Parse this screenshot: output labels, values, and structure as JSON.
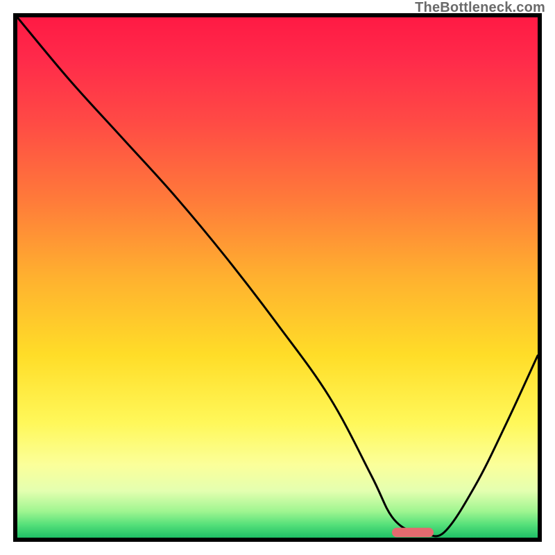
{
  "watermark": "TheBottleneck.com",
  "chart_data": {
    "type": "line",
    "title": "",
    "xlabel": "",
    "ylabel": "",
    "xlim": [
      0,
      100
    ],
    "ylim": [
      0,
      100
    ],
    "series": [
      {
        "name": "bottleneck-curve",
        "x": [
          0,
          10,
          20,
          30,
          40,
          50,
          60,
          68,
          72,
          76,
          78,
          82,
          88,
          94,
          100
        ],
        "y": [
          100,
          88,
          77,
          66,
          54,
          41,
          27,
          12,
          4,
          1,
          1,
          1,
          10,
          22,
          35
        ]
      }
    ],
    "marker": {
      "x_start": 72,
      "x_end": 80,
      "y": 1,
      "color": "#e46a6f"
    },
    "background_gradient": {
      "stops": [
        {
          "offset": 0.0,
          "color": "#ff1a44"
        },
        {
          "offset": 0.08,
          "color": "#ff2a4a"
        },
        {
          "offset": 0.2,
          "color": "#ff4a45"
        },
        {
          "offset": 0.35,
          "color": "#ff7a3a"
        },
        {
          "offset": 0.5,
          "color": "#ffb12f"
        },
        {
          "offset": 0.65,
          "color": "#ffdd28"
        },
        {
          "offset": 0.78,
          "color": "#fff85a"
        },
        {
          "offset": 0.86,
          "color": "#fbff9a"
        },
        {
          "offset": 0.91,
          "color": "#e4ffb0"
        },
        {
          "offset": 0.95,
          "color": "#9ef590"
        },
        {
          "offset": 0.975,
          "color": "#55e07a"
        },
        {
          "offset": 1.0,
          "color": "#1fbf66"
        }
      ]
    }
  }
}
